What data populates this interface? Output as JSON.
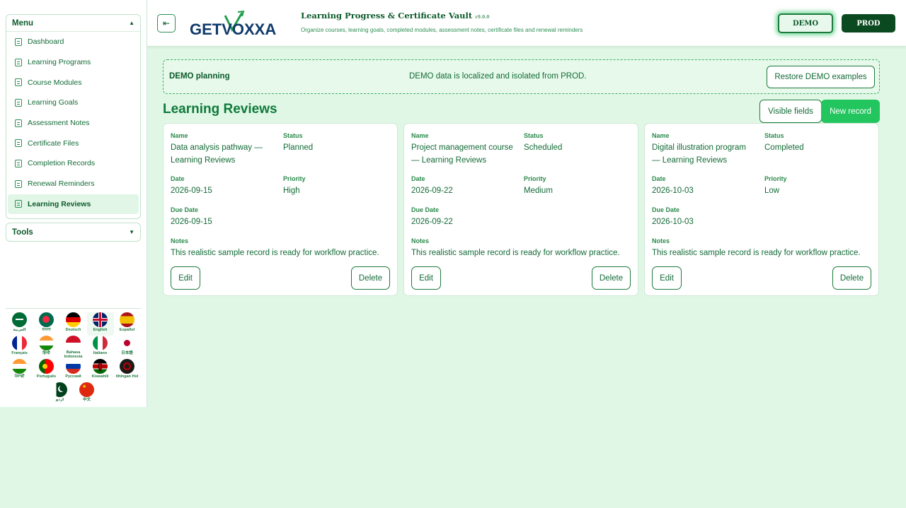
{
  "sidebar": {
    "menu_title": "Menu",
    "items": [
      {
        "label": "Dashboard"
      },
      {
        "label": "Learning Programs"
      },
      {
        "label": "Course Modules"
      },
      {
        "label": "Learning Goals"
      },
      {
        "label": "Assessment Notes"
      },
      {
        "label": "Certificate Files"
      },
      {
        "label": "Completion Records"
      },
      {
        "label": "Renewal Reminders"
      },
      {
        "label": "Learning Reviews",
        "active": true
      }
    ],
    "tools_title": "Tools",
    "languages": [
      {
        "label": "العربية",
        "flag": "saudi-arabia"
      },
      {
        "label": "বাংলা",
        "flag": "bangladesh"
      },
      {
        "label": "Deutsch",
        "flag": "germany"
      },
      {
        "label": "English",
        "flag": "united-kingdom"
      },
      {
        "label": "Español",
        "flag": "spain"
      },
      {
        "label": "Français",
        "flag": "france"
      },
      {
        "label": "हिन्दी",
        "flag": "india"
      },
      {
        "label": "Bahasa Indonesia",
        "flag": "indonesia"
      },
      {
        "label": "Italiano",
        "flag": "italy"
      },
      {
        "label": "日本語",
        "flag": "japan"
      },
      {
        "label": "ਪੰਜਾਬੀ",
        "flag": "india"
      },
      {
        "label": "Português",
        "flag": "portugal"
      },
      {
        "label": "Русский",
        "flag": "russia"
      },
      {
        "label": "Kiswahili",
        "flag": "kenya"
      },
      {
        "label": "tlhIngan Hol",
        "flag": "klingon"
      },
      {
        "label": "اردو",
        "flag": "pakistan"
      },
      {
        "label": "中文",
        "flag": "china"
      }
    ]
  },
  "header": {
    "logo_text": "GETVOXXA",
    "title": "Learning Progress & Certificate Vault",
    "version": "v9.0.0",
    "subtitle": "Organize courses, learning goals, completed modules, assessment notes, certificate files and renewal reminders",
    "demo_label": "DEMO",
    "prod_label": "PROD"
  },
  "banner": {
    "title": "DEMO planning",
    "text": "DEMO data is localized and isolated from PROD.",
    "restore_label": "Restore DEMO examples"
  },
  "main": {
    "title": "Learning Reviews",
    "visible_fields_label": "Visible fields",
    "new_record_label": "New record",
    "labels": {
      "name": "Name",
      "status": "Status",
      "date": "Date",
      "priority": "Priority",
      "due_date": "Due Date",
      "notes": "Notes"
    },
    "edit_label": "Edit",
    "delete_label": "Delete",
    "records": [
      {
        "name_line1": "Data analysis pathway —",
        "name_line2": "Learning Reviews",
        "status": "Planned",
        "date": "2026-09-15",
        "priority": "High",
        "due_date": "2026-09-15",
        "notes": "This realistic sample record is ready for workflow practice."
      },
      {
        "name_line1": "Project management course",
        "name_line2": "— Learning Reviews",
        "status": "Scheduled",
        "date": "2026-09-22",
        "priority": "Medium",
        "due_date": "2026-09-22",
        "notes": "This realistic sample record is ready for workflow practice."
      },
      {
        "name_line1": "Digital illustration program",
        "name_line2": "— Learning Reviews",
        "status": "Completed",
        "date": "2026-10-03",
        "priority": "Low",
        "due_date": "2026-10-03",
        "notes": "This realistic sample record is ready for workflow practice."
      }
    ]
  }
}
